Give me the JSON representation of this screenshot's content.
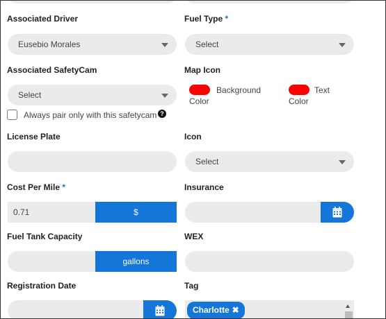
{
  "fields": {
    "associated_driver": {
      "label": "Associated Driver",
      "value": "Eusebio Morales"
    },
    "fuel_type": {
      "label": "Fuel Type",
      "required_mark": "*",
      "value": "Select"
    },
    "associated_safetycam": {
      "label": "Associated SafetyCam",
      "value": "Select"
    },
    "always_pair": {
      "label": "Always pair only with this safetycam",
      "checked": false,
      "help_icon": "?"
    },
    "map_icon": {
      "label": "Map Icon",
      "background_label": "Background",
      "background_label_2": "Color",
      "text_label": "Text",
      "text_label_2": "Color",
      "background_color": "#ff0000",
      "text_color": "#ff0000"
    },
    "license_plate": {
      "label": "License Plate",
      "value": ""
    },
    "icon": {
      "label": "Icon",
      "value": "Select"
    },
    "cost_per_mile": {
      "label": "Cost Per Mile",
      "required_mark": "*",
      "value": "0.71",
      "addon": "$"
    },
    "insurance": {
      "label": "Insurance",
      "value": "",
      "button_icon": "calendar-icon"
    },
    "fuel_tank_capacity": {
      "label": "Fuel Tank Capacity",
      "value": "",
      "addon": "gallons"
    },
    "wex": {
      "label": "WEX",
      "value": ""
    },
    "registration_date": {
      "label": "Registration Date",
      "value": "",
      "button_icon": "calendar-icon"
    },
    "tag": {
      "label": "Tag",
      "chips": [
        "Charlotte"
      ],
      "remove_glyph": "✖"
    }
  },
  "colors": {
    "accent": "#1476d9",
    "required": "#1a73c8",
    "field_bg": "#ebebeb"
  }
}
